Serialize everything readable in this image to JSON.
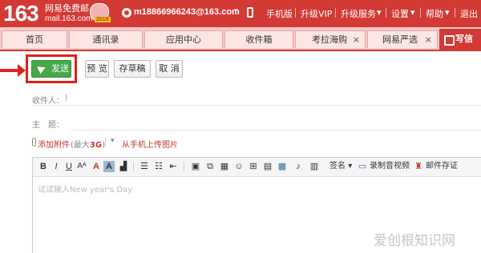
{
  "header": {
    "logo_number": "163",
    "logo_name": "网易免费邮",
    "logo_domain": "mail.163.com",
    "logo_year": "2019",
    "user_email": "m18866966243@163.com",
    "nav": {
      "mobile": "手机版",
      "upgrade_vip": "升级VIP",
      "upgrade_service": "升级服务",
      "settings": "设置",
      "help": "帮助",
      "logout": "退出"
    },
    "caret": "▾"
  },
  "tabs": [
    {
      "label": "首页"
    },
    {
      "label": "通讯录"
    },
    {
      "label": "应用中心"
    },
    {
      "label": "收件箱"
    },
    {
      "label": "考拉海购",
      "close": "×"
    },
    {
      "label": "网易严选",
      "close": "×"
    },
    {
      "label": "写信"
    }
  ],
  "toolbar": {
    "send": "发送",
    "preview": "预 览",
    "save_draft": "存草稿",
    "cancel": "取 消"
  },
  "fields": {
    "recipient_label": "收件人：",
    "subject_label": "主　题："
  },
  "attachment": {
    "add_attachment": "添加附件",
    "limit_prefix": "(最大",
    "limit_value": "3G",
    "limit_suffix": ")",
    "upload_from_phone": "从手机上传图片"
  },
  "editor": {
    "signature": "签名",
    "record_video": "录制音视频",
    "email_save": "邮件存证",
    "placeholder": "试试输入New year's Day"
  },
  "watermark": "爱创根知识网",
  "colors": {
    "brand_red": "#d33a35",
    "send_green": "#47a84a",
    "highlight_red": "#e0201b"
  }
}
